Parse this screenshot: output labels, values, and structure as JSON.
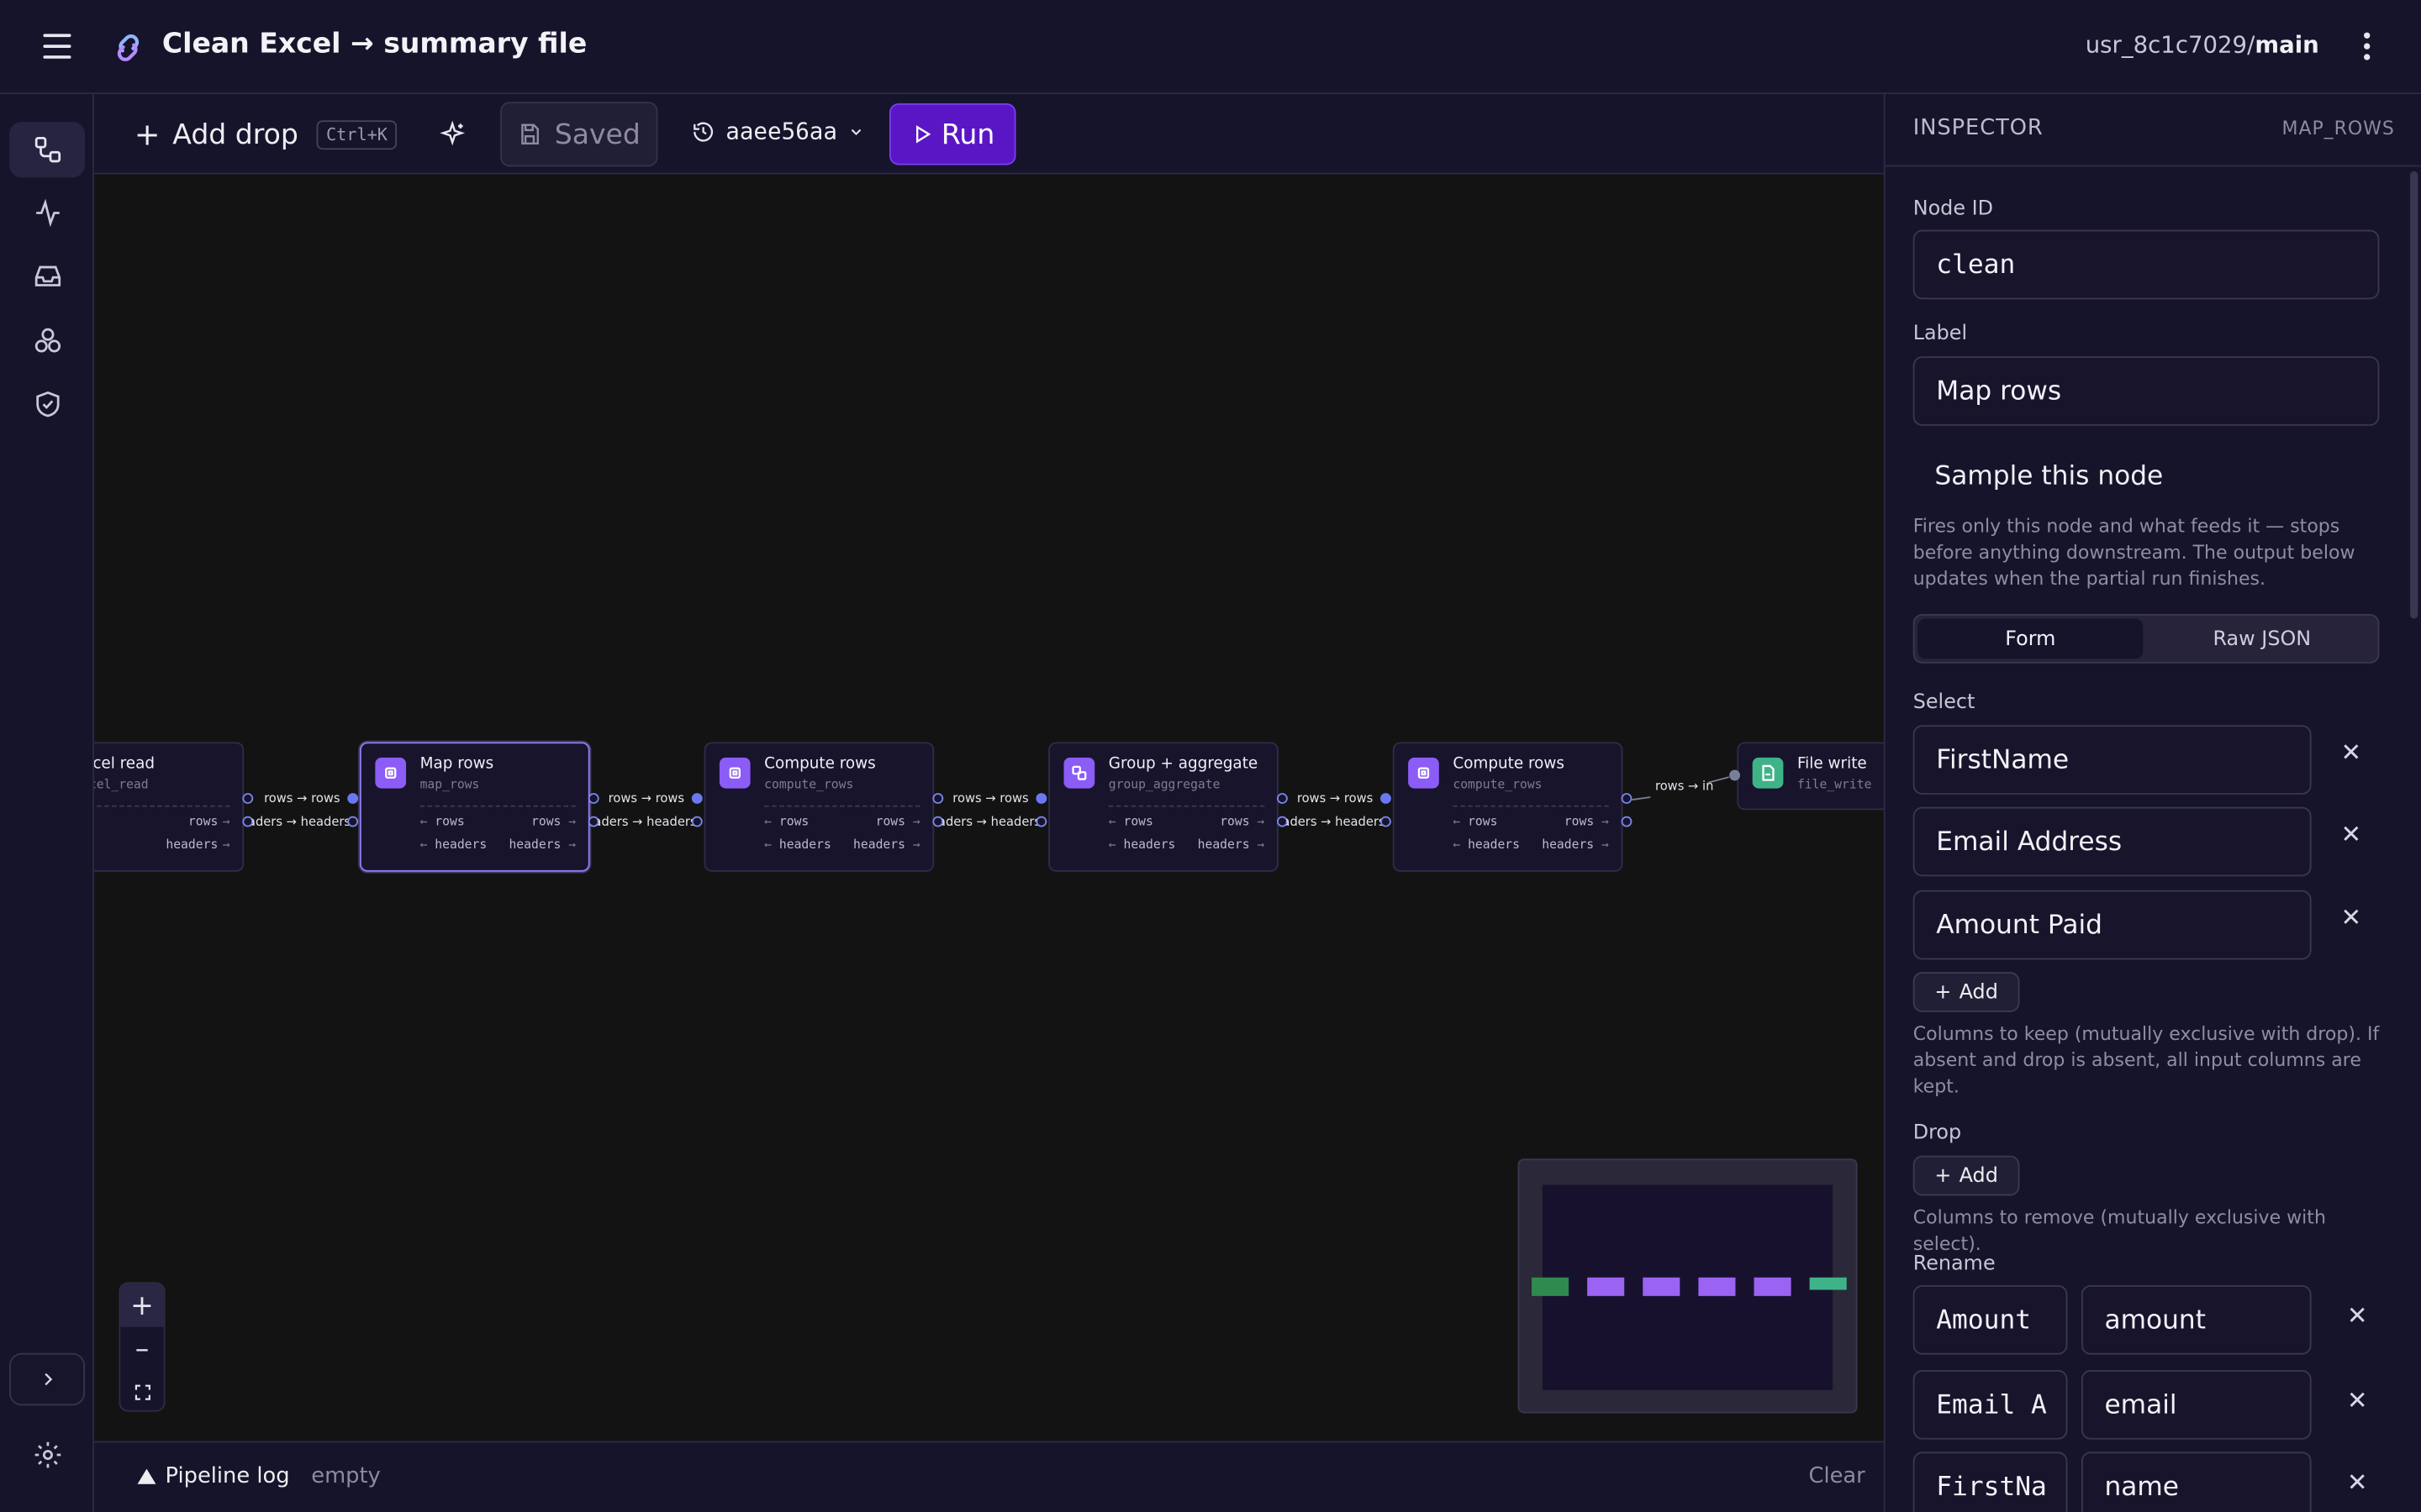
{
  "header": {
    "app_title": "Clean Excel → summary file",
    "user": "usr_8c1c7029/",
    "branch": "main"
  },
  "toolbar": {
    "add_drop_label": "Add drop",
    "add_drop_shortcut": "Ctrl+K",
    "saved_label": "Saved",
    "version": "aaee56aa",
    "run_label": "Run"
  },
  "nodes": [
    {
      "title": "Excel read",
      "type": "excel_read",
      "ports": [
        {
          "in": "",
          "out": "rows"
        },
        {
          "in": "",
          "out": "headers"
        }
      ]
    },
    {
      "title": "Map rows",
      "type": "map_rows",
      "ports": [
        {
          "in": "rows",
          "out": "rows"
        },
        {
          "in": "headers",
          "out": "headers"
        }
      ]
    },
    {
      "title": "Compute rows",
      "type": "compute_rows",
      "ports": [
        {
          "in": "rows",
          "out": "rows"
        },
        {
          "in": "headers",
          "out": "headers"
        }
      ]
    },
    {
      "title": "Group + aggregate",
      "type": "group_aggregate",
      "ports": [
        {
          "in": "rows",
          "out": "rows"
        },
        {
          "in": "headers",
          "out": "headers"
        }
      ]
    },
    {
      "title": "Compute rows",
      "type": "compute_rows",
      "ports": [
        {
          "in": "rows",
          "out": "rows"
        },
        {
          "in": "headers",
          "out": "headers"
        }
      ]
    },
    {
      "title": "File write",
      "type": "file_write",
      "ports": []
    }
  ],
  "edges": {
    "rows": "rows → rows",
    "headers": "headers → headers",
    "final": "rows → in"
  },
  "log": {
    "title": "Pipeline log",
    "state": "empty",
    "clear_label": "Clear"
  },
  "inspector": {
    "title": "INSPECTOR",
    "node_type": "MAP_ROWS",
    "node_id_label": "Node ID",
    "node_id": "clean",
    "label_label": "Label",
    "label_value": "Map rows",
    "sample_label": "Sample this node",
    "sample_help": "Fires only this node and what feeds it — stops before anything downstream. The output below updates when the partial run finishes.",
    "tabs": {
      "form": "Form",
      "raw": "Raw JSON"
    },
    "select_label": "Select",
    "select_items": [
      "FirstName",
      "Email Address",
      "Amount Paid"
    ],
    "add_label": "Add",
    "select_help": "Columns to keep (mutually exclusive with drop). If absent and drop is absent, all input columns are kept.",
    "drop_label": "Drop",
    "drop_help": "Columns to remove (mutually exclusive with select).",
    "rename_label": "Rename",
    "rename_pairs": [
      {
        "from": "Amount",
        "to": "amount"
      },
      {
        "from": "Email A",
        "to": "email"
      },
      {
        "from": "FirstNa",
        "to": "name"
      }
    ]
  },
  "colors": {
    "accent": "#5a16c4",
    "node_icon": "#8b5cf6",
    "file_icon": "#3fb388"
  },
  "icons": [
    "menu-icon",
    "app-logo-icon",
    "more-vert-icon",
    "pipeline-icon",
    "activity-icon",
    "inbox-icon",
    "components-icon",
    "shield-icon",
    "chevron-right-icon",
    "settings-icon",
    "plus-icon",
    "sparkle-icon",
    "save-icon",
    "history-icon",
    "chevron-down-icon",
    "play-icon",
    "close-icon",
    "warning-triangle-icon"
  ]
}
